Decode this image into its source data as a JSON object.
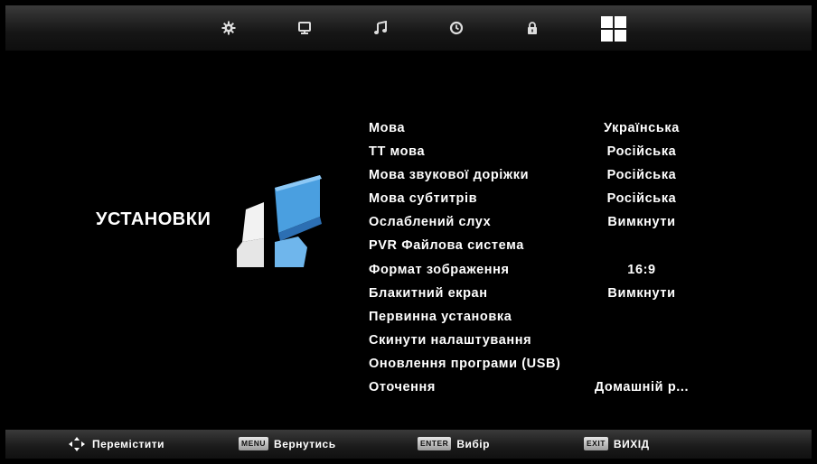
{
  "top_tabs": [
    {
      "icon": "gear-icon",
      "active": false
    },
    {
      "icon": "monitor-icon",
      "active": false
    },
    {
      "icon": "music-note-icon",
      "active": false
    },
    {
      "icon": "clock-icon",
      "active": false
    },
    {
      "icon": "lock-icon",
      "active": false
    },
    {
      "icon": "grid-icon",
      "active": true
    }
  ],
  "section": {
    "title": "УСТАНОВКИ",
    "logo_icon": "setup-cube-icon"
  },
  "menu": {
    "items": [
      {
        "label": "Мова",
        "value": "Українська"
      },
      {
        "label": "ТТ мова",
        "value": "Російська"
      },
      {
        "label": "Мова звукової доріжки",
        "value": "Російська"
      },
      {
        "label": "Мова субтитрів",
        "value": "Російська"
      },
      {
        "label": "Ослаблений слух",
        "value": "Вимкнути"
      },
      {
        "label": "PVR Файлова система",
        "value": ""
      },
      {
        "label": "Формат зображення",
        "value": "16:9"
      },
      {
        "label": "Блакитний екран",
        "value": "Вимкнути"
      },
      {
        "label": "Первинна установка",
        "value": ""
      },
      {
        "label": "Скинути налаштування",
        "value": ""
      },
      {
        "label": "Оновлення програми (USB)",
        "value": ""
      },
      {
        "label": "Оточення",
        "value": "Домашній р..."
      }
    ]
  },
  "bottom_hints": {
    "move": {
      "icon": "arrows-icon",
      "label": "Перемістити"
    },
    "back": {
      "key": "MENU",
      "label": "Вернутись"
    },
    "select": {
      "key": "ENTER",
      "label": "Вибір"
    },
    "exit": {
      "key": "EXIT",
      "label": "ВИХІД"
    }
  },
  "colors": {
    "background": "#000000",
    "text": "#ffffff",
    "logo_blue": "#4a9fe0",
    "logo_white": "#f2f2f2"
  }
}
